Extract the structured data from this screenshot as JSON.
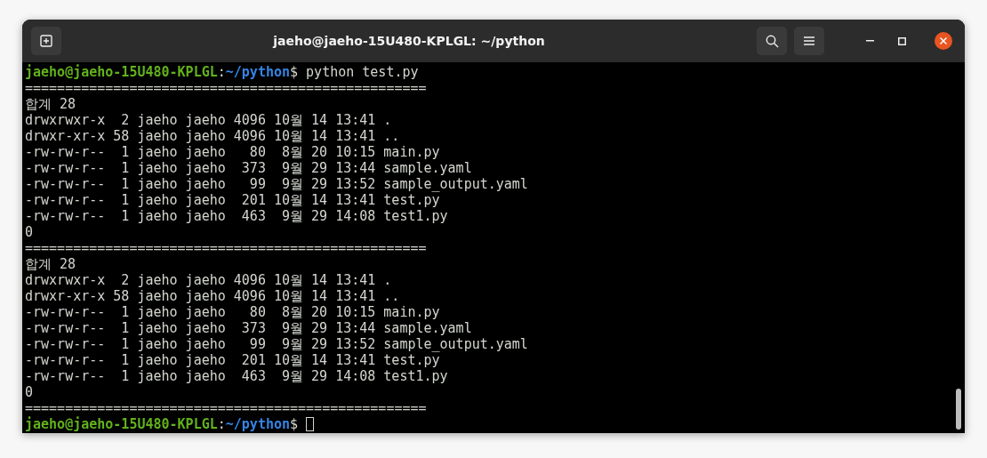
{
  "window": {
    "title": "jaeho@jaeho-15U480-KPLGL: ~/python"
  },
  "terminal": {
    "lines": [
      {
        "kind": "prompt",
        "user_host": "jaeho@jaeho-15U480-KPLGL",
        "separator": ":",
        "path": "~/python",
        "symbol": "$",
        "command": " python test.py"
      },
      {
        "kind": "output",
        "text": "=================================================="
      },
      {
        "kind": "output",
        "text": "합계 28"
      },
      {
        "kind": "output",
        "text": "drwxrwxr-x  2 jaeho jaeho 4096 10월 14 13:41 ."
      },
      {
        "kind": "output",
        "text": "drwxr-xr-x 58 jaeho jaeho 4096 10월 14 13:41 .."
      },
      {
        "kind": "output",
        "text": "-rw-rw-r--  1 jaeho jaeho   80  8월 20 10:15 main.py"
      },
      {
        "kind": "output",
        "text": "-rw-rw-r--  1 jaeho jaeho  373  9월 29 13:44 sample.yaml"
      },
      {
        "kind": "output",
        "text": "-rw-rw-r--  1 jaeho jaeho   99  9월 29 13:52 sample_output.yaml"
      },
      {
        "kind": "output",
        "text": "-rw-rw-r--  1 jaeho jaeho  201 10월 14 13:41 test.py"
      },
      {
        "kind": "output",
        "text": "-rw-rw-r--  1 jaeho jaeho  463  9월 29 14:08 test1.py"
      },
      {
        "kind": "output",
        "text": "0"
      },
      {
        "kind": "output",
        "text": "=================================================="
      },
      {
        "kind": "output",
        "text": "합계 28"
      },
      {
        "kind": "output",
        "text": "drwxrwxr-x  2 jaeho jaeho 4096 10월 14 13:41 ."
      },
      {
        "kind": "output",
        "text": "drwxr-xr-x 58 jaeho jaeho 4096 10월 14 13:41 .."
      },
      {
        "kind": "output",
        "text": "-rw-rw-r--  1 jaeho jaeho   80  8월 20 10:15 main.py"
      },
      {
        "kind": "output",
        "text": "-rw-rw-r--  1 jaeho jaeho  373  9월 29 13:44 sample.yaml"
      },
      {
        "kind": "output",
        "text": "-rw-rw-r--  1 jaeho jaeho   99  9월 29 13:52 sample_output.yaml"
      },
      {
        "kind": "output",
        "text": "-rw-rw-r--  1 jaeho jaeho  201 10월 14 13:41 test.py"
      },
      {
        "kind": "output",
        "text": "-rw-rw-r--  1 jaeho jaeho  463  9월 29 14:08 test1.py"
      },
      {
        "kind": "output",
        "text": "0"
      },
      {
        "kind": "output",
        "text": "=================================================="
      },
      {
        "kind": "prompt",
        "user_host": "jaeho@jaeho-15U480-KPLGL",
        "separator": ":",
        "path": "~/python",
        "symbol": "$",
        "cursor": true
      }
    ]
  }
}
